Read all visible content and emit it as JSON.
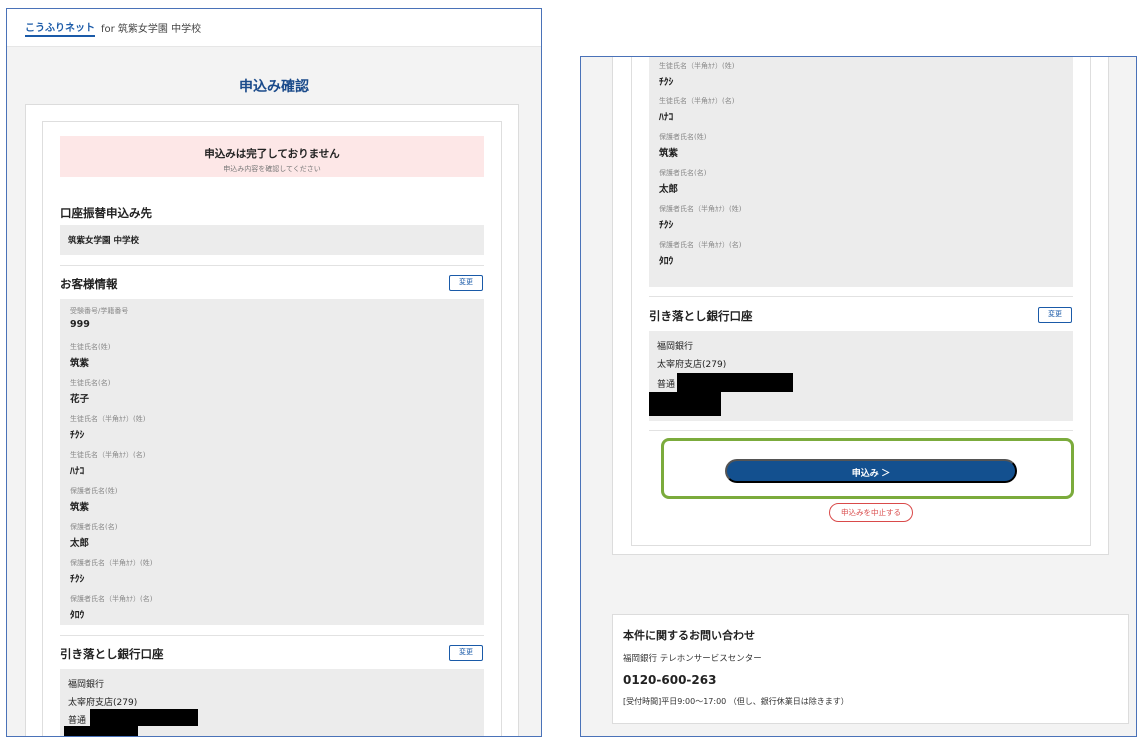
{
  "header": {
    "logo_text": "こうふりネット",
    "for_text": "for 筑紫女学園 中学校"
  },
  "page_title": "申込み確認",
  "alert": {
    "title": "申込みは完了しておりません",
    "subtitle": "申込み内容を確認してください"
  },
  "payee_section": {
    "title": "口座振替申込み先",
    "value": "筑紫女学園 中学校"
  },
  "customer_section": {
    "title": "お客様情報",
    "change_label": "変更",
    "fields": [
      {
        "label": "受験番号/学籍番号",
        "value": "999"
      },
      {
        "label": "生徒氏名(姓)",
        "value": "筑紫"
      },
      {
        "label": "生徒氏名(名)",
        "value": "花子"
      },
      {
        "label": "生徒氏名（半角ｶﾅ）(姓)",
        "value": "ﾁｸｼ"
      },
      {
        "label": "生徒氏名（半角ｶﾅ）(名)",
        "value": "ﾊﾅｺ"
      },
      {
        "label": "保護者氏名(姓)",
        "value": "筑紫"
      },
      {
        "label": "保護者氏名(名)",
        "value": "太郎"
      },
      {
        "label": "保護者氏名（半角ｶﾅ）(姓)",
        "value": "ﾁｸｼ"
      },
      {
        "label": "保護者氏名（半角ｶﾅ）(名)",
        "value": "ﾀﾛｳ"
      }
    ]
  },
  "bank_section": {
    "title": "引き落とし銀行口座",
    "change_label": "変更",
    "bank_name": "福岡銀行",
    "branch": "太宰府支店(279)",
    "account_type": "普通"
  },
  "actions": {
    "apply_label": "申込み ＞",
    "cancel_label": "申込みを中止する"
  },
  "contact": {
    "title": "本件に関するお問い合わせ",
    "name": "福岡銀行 テレホンサービスセンター",
    "phone": "0120-600-263",
    "hours": "[受付時間]平日9:00～17:00 （但し、銀行休業日は除きます）"
  },
  "colors": {
    "primary": "#13508f",
    "alert_bg": "#fde7e7",
    "highlight_frame": "#7bab3c",
    "cancel": "#d94a4a"
  }
}
